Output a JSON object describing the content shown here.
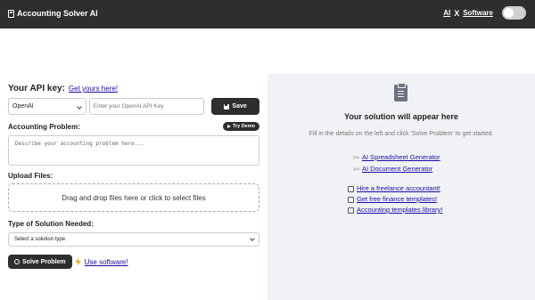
{
  "header": {
    "app_title": "Accounting Solver AI",
    "nav_ai": "AI",
    "nav_x": "X",
    "nav_software": "Software"
  },
  "api": {
    "label": "Your API key:",
    "get_yours": "Get yours here!",
    "provider_selected": "OpenAI",
    "key_placeholder": "Enter your OpenAI API Key",
    "save_label": "Save"
  },
  "problem": {
    "label": "Accounting Problem:",
    "demo_label": "Try Demo",
    "placeholder": "Describe your accounting problem here..."
  },
  "upload": {
    "label": "Upload Files:",
    "dropzone_text": "Drag and drop files here or click to select files"
  },
  "solution_type": {
    "label": "Type of Solution Needed:",
    "selected": "Select a solution type"
  },
  "actions": {
    "solve_label": "Solve Problem",
    "use_software": "Use software!"
  },
  "results": {
    "title": "Your solution will appear here",
    "subtitle": "Fill in the details on the left and click 'Solve Problem' to get started.",
    "generators": [
      {
        "arrow": ">>",
        "label": "AI Spreadsheet Generator"
      },
      {
        "arrow": ">>",
        "label": "AI Document Generator"
      }
    ],
    "resources": [
      {
        "icon": "accountant-icon",
        "label": "Hire a freelance accountant!"
      },
      {
        "icon": "template-icon",
        "label": "Get free finance templates!"
      },
      {
        "icon": "library-icon",
        "label": "Accounting templates library!"
      }
    ]
  }
}
